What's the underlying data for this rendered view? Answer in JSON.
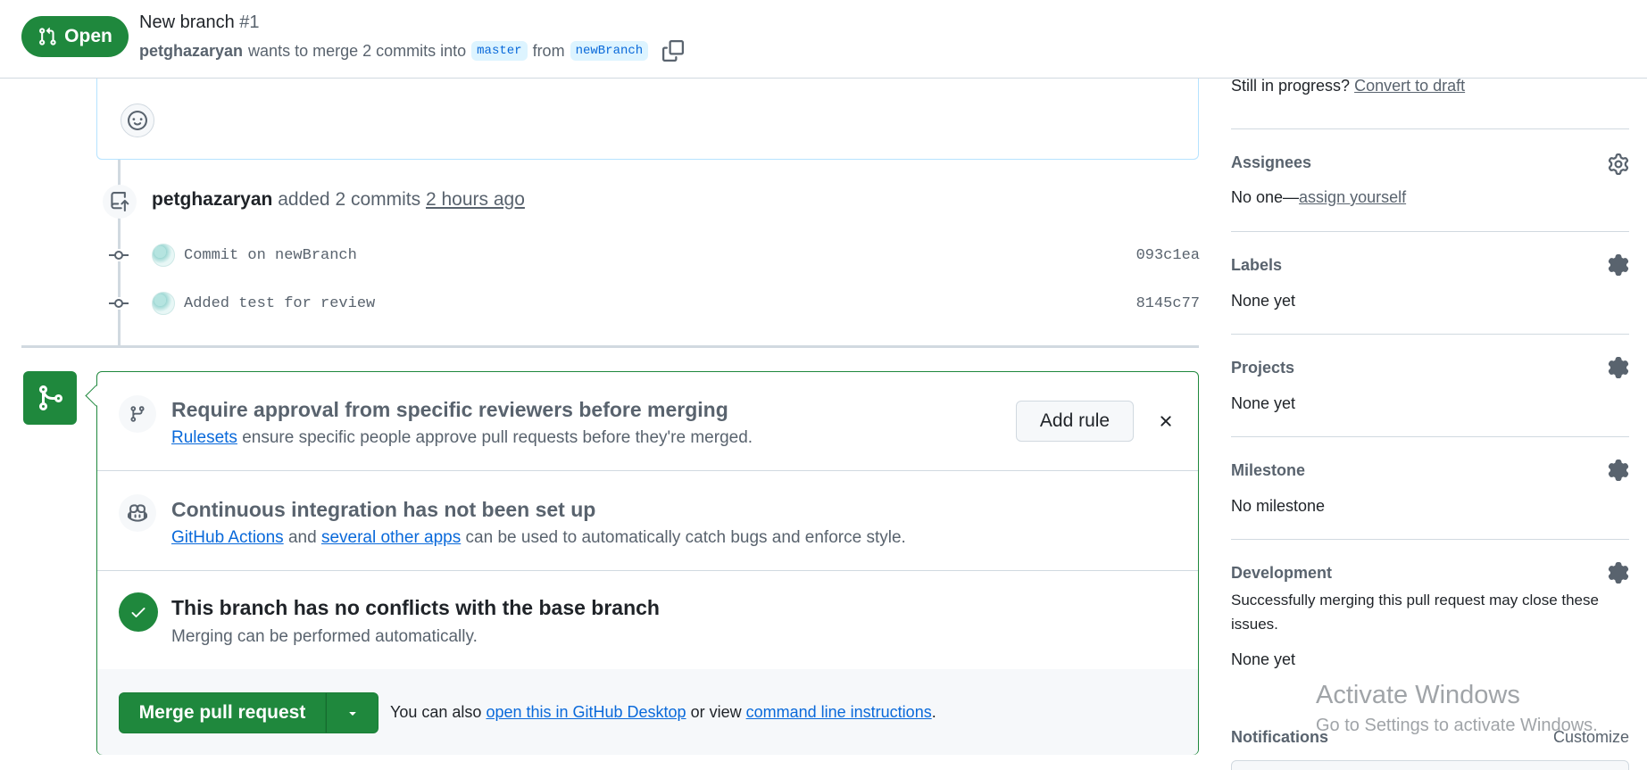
{
  "header": {
    "state": "Open",
    "title": "New branch",
    "number": "#1",
    "author": "petghazaryan",
    "merge_text": "wants to merge 2 commits into",
    "base_branch": "master",
    "from_text": "from",
    "head_branch": "newBranch"
  },
  "timeline": {
    "push_author": "petghazaryan",
    "push_action": "added 2 commits",
    "push_time": "2 hours ago",
    "commits": [
      {
        "message": "Commit on newBranch",
        "sha": "093c1ea"
      },
      {
        "message": "Added test for review",
        "sha": "8145c77"
      }
    ]
  },
  "merge_box": {
    "ruleset_title": "Require approval from specific reviewers before merging",
    "ruleset_link": "Rulesets",
    "ruleset_desc": "ensure specific people approve pull requests before they're merged.",
    "add_rule_label": "Add rule",
    "ci_title": "Continuous integration has not been set up",
    "ci_link1": "GitHub Actions",
    "ci_and": "and",
    "ci_link2": "several other apps",
    "ci_desc": "can be used to automatically catch bugs and enforce style.",
    "conflict_title": "This branch has no conflicts with the base branch",
    "conflict_desc": "Merging can be performed automatically.",
    "merge_button": "Merge pull request",
    "note_prefix": "You can also",
    "note_link1": "open this in GitHub Desktop",
    "note_mid": "or view",
    "note_link2": "command line instructions",
    "note_end": "."
  },
  "sidebar": {
    "progress_text": "Still in progress?",
    "convert_link": "Convert to draft",
    "assignees": {
      "heading": "Assignees",
      "value_prefix": "No one—",
      "value_link": "assign yourself"
    },
    "labels": {
      "heading": "Labels",
      "value": "None yet"
    },
    "projects": {
      "heading": "Projects",
      "value": "None yet"
    },
    "milestone": {
      "heading": "Milestone",
      "value": "No milestone"
    },
    "development": {
      "heading": "Development",
      "desc": "Successfully merging this pull request may close these issues.",
      "value": "None yet"
    },
    "notifications": {
      "heading": "Notifications",
      "customize": "Customize"
    }
  },
  "watermark": {
    "line1": "Activate Windows",
    "line2": "Go to Settings to activate Windows."
  },
  "colors": {
    "accent_green": "#1f883d",
    "link_blue": "#0969da",
    "muted": "#59636e"
  }
}
